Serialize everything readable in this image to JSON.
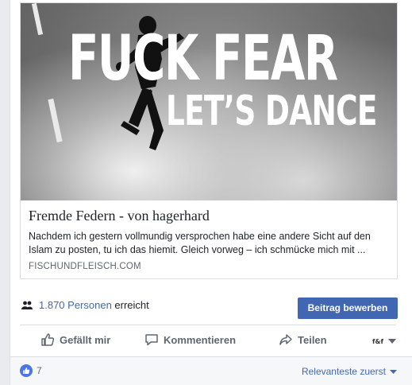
{
  "link_preview": {
    "image_headline_1": "FUCK FEAR",
    "image_headline_2": "LET’S DANCE",
    "title": "Fremde Federn - von hagerhard",
    "description": "Nachdem ich gestern vollmundig versprochen habe eine andere Sicht auf den Islam zu posten, tu ich das hiemit. Gleich vorweg – ich schmücke mich mit ...",
    "domain": "FISCHUNDFLEISCH.COM"
  },
  "reach": {
    "count_link": "1.870 Personen",
    "suffix": "erreicht",
    "icon": "people-icon"
  },
  "promote_button": "Beitrag bewerben",
  "actions": {
    "like": "Gefällt mir",
    "comment": "Kommentieren",
    "share": "Teilen",
    "audience_icon": "audience-selector-icon"
  },
  "footer": {
    "like_count": "7",
    "sort_label": "Relevanteste zuerst"
  },
  "colors": {
    "accent": "#4267b2",
    "text_secondary": "#606770",
    "like_blue": "#4a76e8"
  }
}
